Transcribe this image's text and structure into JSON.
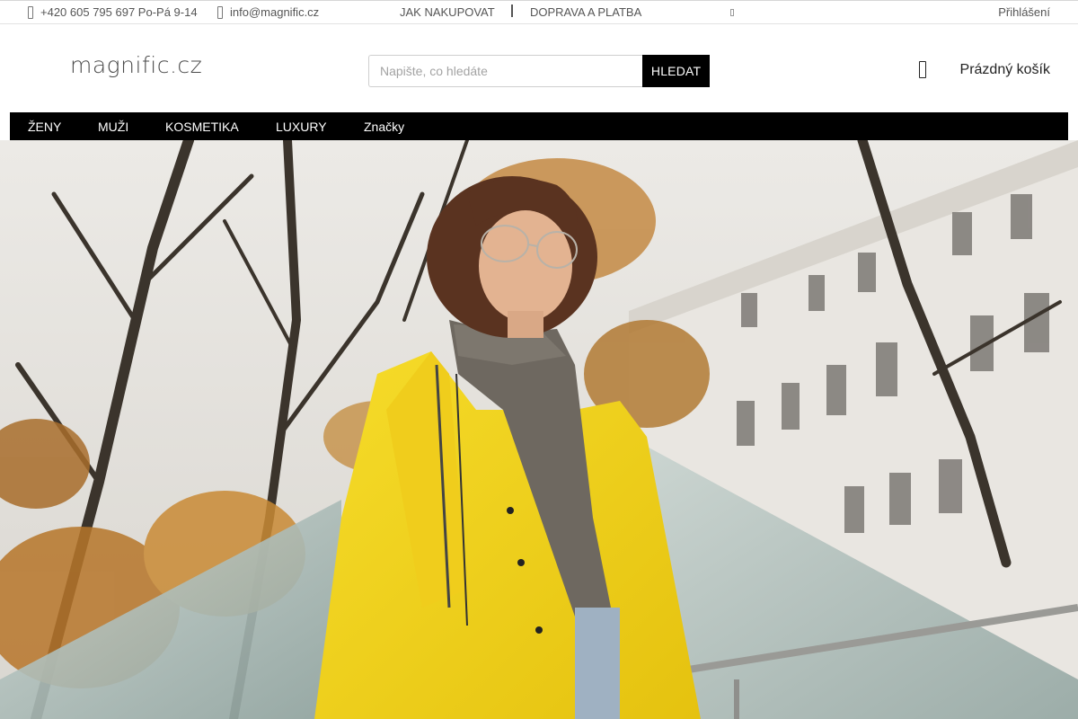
{
  "topbar": {
    "phone": "+420 605 795 697 Po-Pá 9-14",
    "email": "info@magnific.cz",
    "link_how_to_buy": "JAK NAKUPOVAT",
    "link_shipping": "DOPRAVA A PLATBA",
    "login": "Přihlášení"
  },
  "header": {
    "logo": "magnific.cz",
    "search": {
      "placeholder": "Napište, co hledáte",
      "button": "HLEDAT"
    },
    "cart_label": "Prázdný košík"
  },
  "nav": {
    "items": [
      {
        "label": "ŽENY"
      },
      {
        "label": "MUŽI"
      },
      {
        "label": "KOSMETIKA"
      },
      {
        "label": "LUXURY"
      },
      {
        "label": "Značky"
      }
    ]
  },
  "hero": {
    "image": "woman-in-yellow-raincoat-photo"
  },
  "colors": {
    "nav_bg": "#000000",
    "search_button_bg": "#000000",
    "coat": "#f2d21c"
  }
}
